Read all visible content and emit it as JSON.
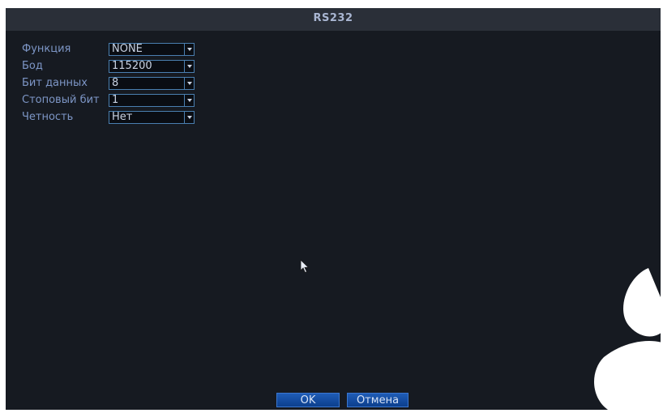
{
  "window": {
    "title": "RS232"
  },
  "fields": [
    {
      "label": "Функция",
      "value": "NONE"
    },
    {
      "label": "Бод",
      "value": "115200"
    },
    {
      "label": "Бит данных",
      "value": "8"
    },
    {
      "label": "Стоповый бит",
      "value": "1"
    },
    {
      "label": "Четность",
      "value": "Нет"
    }
  ],
  "buttons": {
    "ok": "OK",
    "cancel": "Отмена"
  },
  "colors": {
    "background": "#161a21",
    "label": "#7d96c6",
    "button": "#1f5cb6"
  },
  "icons": {
    "cursor": "mouse-pointer-icon",
    "dropdown": "chevron-down-icon"
  }
}
